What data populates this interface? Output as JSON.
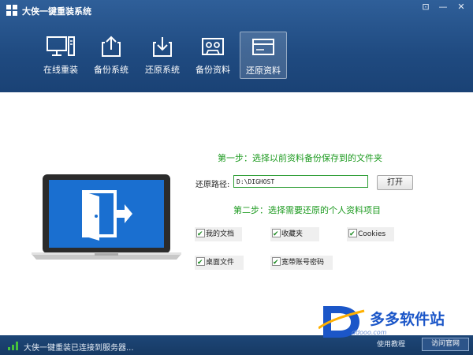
{
  "app": {
    "title": "大侠一键重装系统"
  },
  "window_controls": {
    "feedback": "⊡",
    "minimize": "—",
    "close": "✕"
  },
  "nav": [
    {
      "label": "在线重装",
      "icon": "monitor-icon"
    },
    {
      "label": "备份系统",
      "icon": "upload-box-icon"
    },
    {
      "label": "还原系统",
      "icon": "download-box-icon"
    },
    {
      "label": "备份资料",
      "icon": "cassette-icon"
    },
    {
      "label": "还原资料",
      "icon": "card-icon",
      "active": true
    }
  ],
  "main": {
    "step1_title": "第一步：选择以前资料备份保存到的文件夹",
    "path_label": "还原路径:",
    "path_value": "D:\\DIGHOST",
    "open_button": "打开",
    "step2_title": "第二步：选择需要还原的个人资料项目",
    "items": [
      {
        "label": "我的文档",
        "checked": true
      },
      {
        "label": "收藏夹",
        "checked": true
      },
      {
        "label": "Cookies",
        "checked": true
      },
      {
        "label": "桌面文件",
        "checked": true
      },
      {
        "label": "宽带账号密码",
        "checked": true
      }
    ]
  },
  "status": {
    "text": "大侠一键重装已连接到服务器..."
  },
  "watermark": {
    "brand": "多多软件站",
    "url": "ddooo.com",
    "use_help": "使用教程",
    "official": "访问官网"
  },
  "colors": {
    "header": "#1f4a80",
    "step_text": "#1c9a1f",
    "input_border": "#2e9e35",
    "screen": "#1a6fd0"
  }
}
